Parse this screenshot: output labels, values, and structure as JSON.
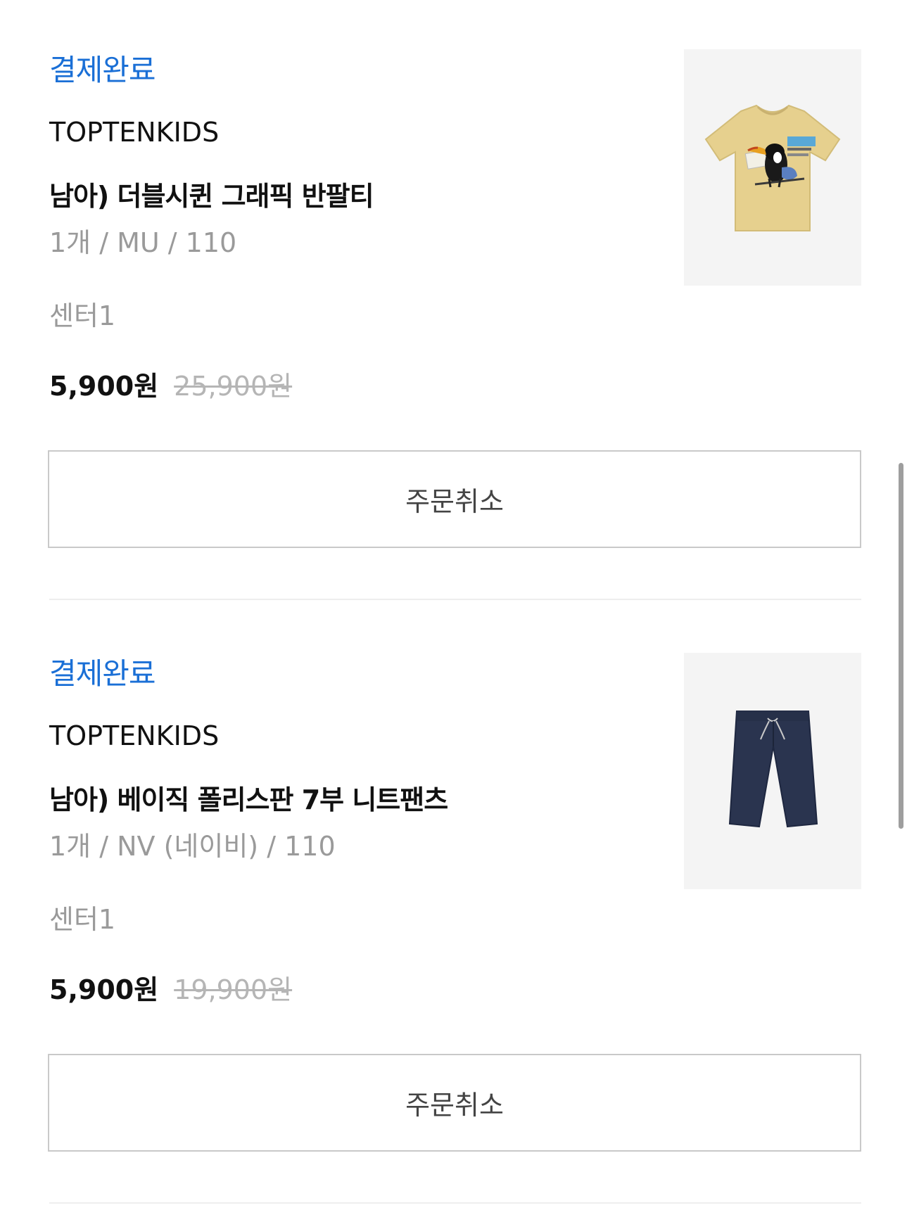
{
  "orders": [
    {
      "status": "결제완료",
      "brand": "TOPTENKIDS",
      "product_name": "남아) 더블시퀸 그래픽 반팔티",
      "options": "1개 / MU / 110",
      "center": "센터1",
      "price": "5,900원",
      "original_price": "25,900원",
      "image_icon": "yellow-tshirt-toucan-icon",
      "cancel_label": "주문취소"
    },
    {
      "status": "결제완료",
      "brand": "TOPTENKIDS",
      "product_name": "남아) 베이직 폴리스판 7부 니트팬츠",
      "options": "1개 / NV (네이비) / 110",
      "center": "센터1",
      "price": "5,900원",
      "original_price": "19,900원",
      "image_icon": "navy-shorts-icon",
      "cancel_label": "주문취소"
    }
  ],
  "colors": {
    "status": "#1a6fd6",
    "muted_text": "#9a9a9a",
    "strike_price": "#b5b5b5",
    "tshirt": "#e6d08e",
    "pants": "#2a344f"
  }
}
